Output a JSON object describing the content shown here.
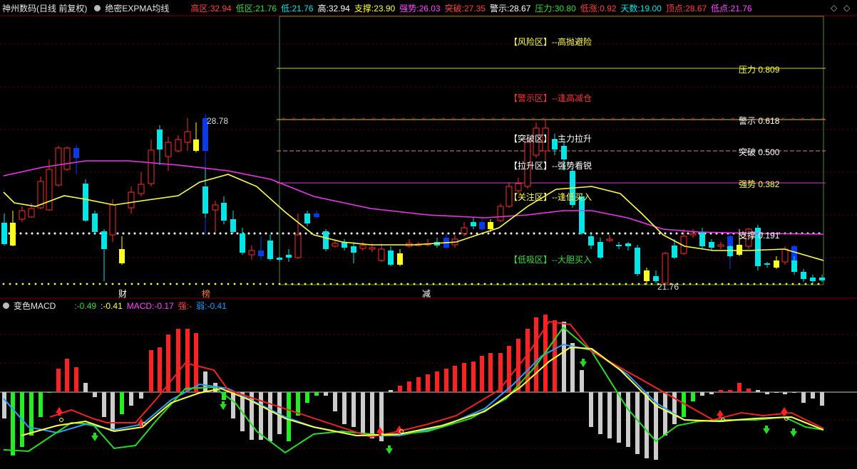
{
  "header": {
    "title": "神州数码(日线 前复权)",
    "indicator_name": "绝密EXPMA均线",
    "stats": [
      {
        "label": "高区:",
        "value": "32.94",
        "color": "#ff4040"
      },
      {
        "label": "低区:",
        "value": "21.76",
        "color": "#33dd33"
      },
      {
        "label": "低:",
        "value": "21.76",
        "color": "#00e5e5"
      },
      {
        "label": "高:",
        "value": "32.94",
        "color": "#ffffff"
      },
      {
        "label": "支撑:",
        "value": "23.90",
        "color": "#ffff33"
      },
      {
        "label": "强势:",
        "value": "26.03",
        "color": "#ff44ff"
      },
      {
        "label": "突破:",
        "value": "27.35",
        "color": "#ff4040"
      },
      {
        "label": "警示:",
        "value": "28.67",
        "color": "#ffffff"
      },
      {
        "label": "压力:",
        "value": "30.80",
        "color": "#33dd33"
      },
      {
        "label": "低涨:",
        "value": "0.92",
        "color": "#ff4040"
      },
      {
        "label": "天数:",
        "value": "19.00",
        "color": "#00e5e5"
      },
      {
        "label": "顶点:",
        "value": "28.67",
        "color": "#ff4040"
      },
      {
        "label": "低点:",
        "value": "21.76",
        "color": "#ff44ff"
      }
    ]
  },
  "zones": [
    {
      "text": "【风险区】--高抛避险",
      "color": "#ffff44"
    },
    {
      "text": "【警示区】--逢高减仓",
      "color": "#ff3030"
    },
    {
      "text": "【突破区】--主力拉升",
      "color": "#ffffff"
    },
    {
      "text": "【拉升区】--强势看锐",
      "color": "#ffffff"
    },
    {
      "text": "【关注区】--逢低买入",
      "color": "#ffff44"
    },
    {
      "text": "【低吸区】--大胆买入",
      "color": "#33dd33"
    }
  ],
  "levels": [
    {
      "text": "压力 0.809",
      "color": "#ffff44"
    },
    {
      "text": "警示 0.618",
      "color": "#ffffff"
    },
    {
      "text": "突破 0.500",
      "color": "#ffffff"
    },
    {
      "text": "强势 0.382",
      "color": "#ffff44"
    },
    {
      "text": "支撑 0.191",
      "color": "#ffffff"
    }
  ],
  "annotations": {
    "high_price": "28.78",
    "low_price": "21.76",
    "markers": [
      "财",
      "榜",
      "减"
    ]
  },
  "macd": {
    "name": "变色MACD",
    "stats": [
      {
        "label": ":",
        "value": "-0.49",
        "color": "#33dd33"
      },
      {
        "label": ":",
        "value": "-0.41",
        "color": "#ffff44"
      },
      {
        "label": "MACD:",
        "value": "-0.17",
        "color": "#ff44ff"
      },
      {
        "label": "强:",
        "value": "-",
        "color": "#ff4040"
      },
      {
        "label": "弱:",
        "value": "-0.41",
        "color": "#00a0ff"
      }
    ]
  },
  "colors": {
    "up": "#ff3030",
    "down": "#00e5e5",
    "blue": "#0a3ae8",
    "yellow": "#ffff22",
    "magenta": "#ee33ee",
    "ema_yellow": "#ffff44"
  }
}
